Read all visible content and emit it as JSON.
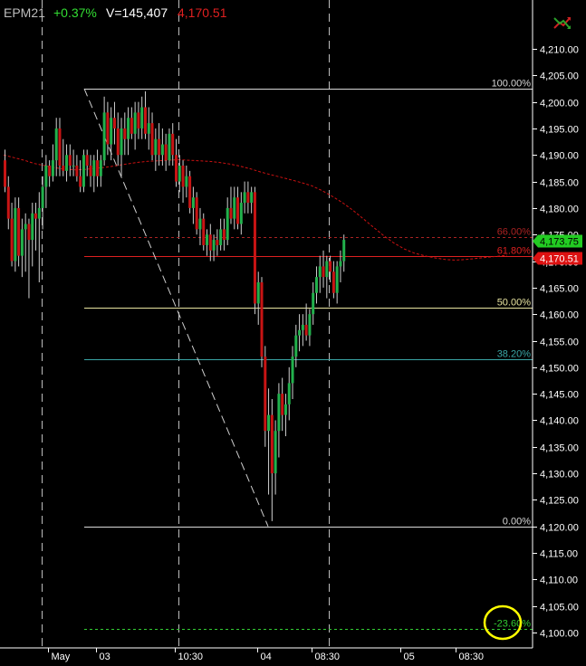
{
  "header": {
    "symbol": "EPM21",
    "change": "+0.37%",
    "volume": "V=145,407",
    "last": "4,170.51"
  },
  "colors": {
    "background": "#000000",
    "up": "#22b14c",
    "down": "#c81414",
    "header_symbol": "#bdbdbd",
    "header_change": "#33dd33",
    "header_volume": "#ffffff",
    "header_last": "#e02020",
    "ma": "#cc1111",
    "fib_100": "#d8d8d8",
    "fib_66": "#aa2222",
    "fib_618": "#dd2020",
    "fib_50": "#e8e4a0",
    "fib_382": "#3aa6a6",
    "fib_0": "#d8d8d8",
    "fib_neg236": "#33cc33",
    "price_tag_current": "#22cc22",
    "price_tag_last": "#dd1111",
    "highlight_circle": "#ffff00"
  },
  "chart_data": {
    "type": "candlestick",
    "instrument": "EPM21",
    "ylim": [
      4095,
      4215
    ],
    "y_ticks": [
      "4,100.00",
      "4,105.00",
      "4,110.00",
      "4,115.00",
      "4,120.00",
      "4,125.00",
      "4,130.00",
      "4,135.00",
      "4,140.00",
      "4,145.00",
      "4,150.00",
      "4,155.00",
      "4,160.00",
      "4,165.00",
      "4,170.00",
      "4,175.00",
      "4,180.00",
      "4,185.00",
      "4,190.00",
      "4,195.00",
      "4,200.00",
      "4,205.00",
      "4,210.00"
    ],
    "y_tick_values": [
      4100,
      4105,
      4110,
      4115,
      4120,
      4125,
      4130,
      4135,
      4140,
      4145,
      4150,
      4155,
      4160,
      4165,
      4170,
      4175,
      4180,
      4185,
      4190,
      4195,
      4200,
      4205,
      4210
    ],
    "x_ticks": [
      {
        "label": "May",
        "bar": 13
      },
      {
        "label": "03",
        "bar": 27
      },
      {
        "label": "10:30",
        "bar": 50
      },
      {
        "label": "04",
        "bar": 74
      },
      {
        "label": "08:30",
        "bar": 90
      },
      {
        "label": "05",
        "bar": 116
      },
      {
        "label": "08:30",
        "bar": 132
      }
    ],
    "session_dividers": [
      11,
      51,
      95
    ],
    "candles": [
      {
        "o": 4189,
        "h": 4191,
        "l": 4183,
        "c": 4184
      },
      {
        "o": 4184,
        "h": 4186,
        "l": 4176,
        "c": 4178
      },
      {
        "o": 4178,
        "h": 4181,
        "l": 4169,
        "c": 4170
      },
      {
        "o": 4170,
        "h": 4182,
        "l": 4168,
        "c": 4180
      },
      {
        "o": 4180,
        "h": 4182,
        "l": 4169,
        "c": 4171
      },
      {
        "o": 4171,
        "h": 4178,
        "l": 4167,
        "c": 4176
      },
      {
        "o": 4176,
        "h": 4179,
        "l": 4168,
        "c": 4177
      },
      {
        "o": 4177,
        "h": 4178,
        "l": 4163,
        "c": 4174
      },
      {
        "o": 4174,
        "h": 4181,
        "l": 4169,
        "c": 4179
      },
      {
        "o": 4179,
        "h": 4181,
        "l": 4172,
        "c": 4178
      },
      {
        "o": 4178,
        "h": 4183,
        "l": 4166,
        "c": 4180
      },
      {
        "o": 4180,
        "h": 4186,
        "l": 4176,
        "c": 4184
      },
      {
        "o": 4184,
        "h": 4190,
        "l": 4180,
        "c": 4188
      },
      {
        "o": 4188,
        "h": 4189,
        "l": 4184,
        "c": 4186
      },
      {
        "o": 4186,
        "h": 4192,
        "l": 4185,
        "c": 4189
      },
      {
        "o": 4189,
        "h": 4197,
        "l": 4186,
        "c": 4195
      },
      {
        "o": 4195,
        "h": 4197,
        "l": 4186,
        "c": 4188
      },
      {
        "o": 4188,
        "h": 4193,
        "l": 4186,
        "c": 4187
      },
      {
        "o": 4187,
        "h": 4192,
        "l": 4185,
        "c": 4190
      },
      {
        "o": 4190,
        "h": 4192,
        "l": 4186,
        "c": 4188
      },
      {
        "o": 4188,
        "h": 4191,
        "l": 4186,
        "c": 4188
      },
      {
        "o": 4188,
        "h": 4190,
        "l": 4185,
        "c": 4186
      },
      {
        "o": 4186,
        "h": 4189,
        "l": 4183,
        "c": 4184
      },
      {
        "o": 4184,
        "h": 4191,
        "l": 4183,
        "c": 4190
      },
      {
        "o": 4190,
        "h": 4191,
        "l": 4186,
        "c": 4188
      },
      {
        "o": 4188,
        "h": 4190,
        "l": 4184,
        "c": 4186
      },
      {
        "o": 4186,
        "h": 4190,
        "l": 4183,
        "c": 4189
      },
      {
        "o": 4189,
        "h": 4191,
        "l": 4184,
        "c": 4186
      },
      {
        "o": 4186,
        "h": 4190,
        "l": 4184,
        "c": 4189
      },
      {
        "o": 4189,
        "h": 4201,
        "l": 4188,
        "c": 4198
      },
      {
        "o": 4198,
        "h": 4200,
        "l": 4190,
        "c": 4192
      },
      {
        "o": 4192,
        "h": 4199,
        "l": 4189,
        "c": 4197
      },
      {
        "o": 4197,
        "h": 4200,
        "l": 4192,
        "c": 4195
      },
      {
        "o": 4195,
        "h": 4198,
        "l": 4188,
        "c": 4190
      },
      {
        "o": 4190,
        "h": 4197,
        "l": 4186,
        "c": 4195
      },
      {
        "o": 4195,
        "h": 4198,
        "l": 4190,
        "c": 4193
      },
      {
        "o": 4193,
        "h": 4199,
        "l": 4190,
        "c": 4197
      },
      {
        "o": 4197,
        "h": 4199,
        "l": 4193,
        "c": 4194
      },
      {
        "o": 4194,
        "h": 4200,
        "l": 4191,
        "c": 4198
      },
      {
        "o": 4198,
        "h": 4200,
        "l": 4193,
        "c": 4195
      },
      {
        "o": 4195,
        "h": 4201,
        "l": 4193,
        "c": 4199
      },
      {
        "o": 4199,
        "h": 4202,
        "l": 4193,
        "c": 4194
      },
      {
        "o": 4194,
        "h": 4199,
        "l": 4191,
        "c": 4196
      },
      {
        "o": 4196,
        "h": 4198,
        "l": 4189,
        "c": 4190
      },
      {
        "o": 4190,
        "h": 4195,
        "l": 4187,
        "c": 4193
      },
      {
        "o": 4193,
        "h": 4196,
        "l": 4188,
        "c": 4190
      },
      {
        "o": 4190,
        "h": 4195,
        "l": 4188,
        "c": 4192
      },
      {
        "o": 4192,
        "h": 4194,
        "l": 4187,
        "c": 4189
      },
      {
        "o": 4189,
        "h": 4195,
        "l": 4188,
        "c": 4194
      },
      {
        "o": 4194,
        "h": 4196,
        "l": 4188,
        "c": 4190
      },
      {
        "o": 4190,
        "h": 4193,
        "l": 4184,
        "c": 4185
      },
      {
        "o": 4185,
        "h": 4190,
        "l": 4183,
        "c": 4188
      },
      {
        "o": 4188,
        "h": 4189,
        "l": 4181,
        "c": 4184
      },
      {
        "o": 4184,
        "h": 4188,
        "l": 4182,
        "c": 4186
      },
      {
        "o": 4186,
        "h": 4187,
        "l": 4179,
        "c": 4180
      },
      {
        "o": 4180,
        "h": 4184,
        "l": 4177,
        "c": 4182
      },
      {
        "o": 4182,
        "h": 4183,
        "l": 4175,
        "c": 4176
      },
      {
        "o": 4176,
        "h": 4180,
        "l": 4173,
        "c": 4178
      },
      {
        "o": 4178,
        "h": 4179,
        "l": 4172,
        "c": 4173
      },
      {
        "o": 4173,
        "h": 4176,
        "l": 4171,
        "c": 4175
      },
      {
        "o": 4175,
        "h": 4177,
        "l": 4170,
        "c": 4172
      },
      {
        "o": 4172,
        "h": 4175,
        "l": 4170,
        "c": 4174
      },
      {
        "o": 4174,
        "h": 4176,
        "l": 4171,
        "c": 4173
      },
      {
        "o": 4173,
        "h": 4178,
        "l": 4172,
        "c": 4176
      },
      {
        "o": 4176,
        "h": 4178,
        "l": 4172,
        "c": 4174
      },
      {
        "o": 4174,
        "h": 4182,
        "l": 4173,
        "c": 4180
      },
      {
        "o": 4180,
        "h": 4184,
        "l": 4177,
        "c": 4178
      },
      {
        "o": 4178,
        "h": 4184,
        "l": 4176,
        "c": 4182
      },
      {
        "o": 4182,
        "h": 4184,
        "l": 4176,
        "c": 4177
      },
      {
        "o": 4177,
        "h": 4183,
        "l": 4175,
        "c": 4181
      },
      {
        "o": 4181,
        "h": 4185,
        "l": 4179,
        "c": 4183
      },
      {
        "o": 4183,
        "h": 4185,
        "l": 4179,
        "c": 4181
      },
      {
        "o": 4181,
        "h": 4184,
        "l": 4179,
        "c": 4183
      },
      {
        "o": 4183,
        "h": 4184,
        "l": 4160,
        "c": 4162
      },
      {
        "o": 4162,
        "h": 4168,
        "l": 4158,
        "c": 4166
      },
      {
        "o": 4166,
        "h": 4167,
        "l": 4150,
        "c": 4152
      },
      {
        "o": 4152,
        "h": 4154,
        "l": 4135,
        "c": 4138
      },
      {
        "o": 4138,
        "h": 4146,
        "l": 4126,
        "c": 4141
      },
      {
        "o": 4141,
        "h": 4144,
        "l": 4121,
        "c": 4130
      },
      {
        "o": 4130,
        "h": 4140,
        "l": 4126,
        "c": 4138
      },
      {
        "o": 4138,
        "h": 4147,
        "l": 4133,
        "c": 4145
      },
      {
        "o": 4145,
        "h": 4148,
        "l": 4138,
        "c": 4141
      },
      {
        "o": 4141,
        "h": 4145,
        "l": 4137,
        "c": 4143
      },
      {
        "o": 4143,
        "h": 4150,
        "l": 4140,
        "c": 4147
      },
      {
        "o": 4147,
        "h": 4154,
        "l": 4144,
        "c": 4152
      },
      {
        "o": 4152,
        "h": 4158,
        "l": 4150,
        "c": 4156
      },
      {
        "o": 4156,
        "h": 4160,
        "l": 4153,
        "c": 4157
      },
      {
        "o": 4157,
        "h": 4160,
        "l": 4154,
        "c": 4158
      },
      {
        "o": 4158,
        "h": 4162,
        "l": 4155,
        "c": 4156
      },
      {
        "o": 4156,
        "h": 4161,
        "l": 4154,
        "c": 4160
      },
      {
        "o": 4160,
        "h": 4166,
        "l": 4158,
        "c": 4164
      },
      {
        "o": 4164,
        "h": 4169,
        "l": 4162,
        "c": 4167
      },
      {
        "o": 4167,
        "h": 4171,
        "l": 4164,
        "c": 4169
      },
      {
        "o": 4169,
        "h": 4172,
        "l": 4165,
        "c": 4167
      },
      {
        "o": 4167,
        "h": 4171,
        "l": 4163,
        "c": 4170
      },
      {
        "o": 4170,
        "h": 4171,
        "l": 4166,
        "c": 4168
      },
      {
        "o": 4168,
        "h": 4170,
        "l": 4163,
        "c": 4164
      },
      {
        "o": 4164,
        "h": 4170,
        "l": 4162,
        "c": 4169
      },
      {
        "o": 4169,
        "h": 4172,
        "l": 4166,
        "c": 4170
      },
      {
        "o": 4170,
        "h": 4175,
        "l": 4168,
        "c": 4174
      }
    ],
    "moving_average": [
      4190,
      4189.5,
      4189,
      4188.4,
      4188,
      4187.6,
      4187.3,
      4187.2,
      4187.3,
      4187.5,
      4187.7,
      4188,
      4188.3,
      4188.6,
      4188.8,
      4188.9,
      4189,
      4189.1,
      4189,
      4188.9,
      4188.8,
      4188.6,
      4188.3,
      4187.9,
      4187.4,
      4186.8,
      4186.3,
      4185.8,
      4185.3,
      4184.8,
      4184.2,
      4183.3,
      4182.2,
      4181,
      4179.6,
      4178,
      4176.4,
      4174.8,
      4173.4,
      4172.3,
      4171.5,
      4171,
      4170.6,
      4170.3,
      4170.2,
      4170.3,
      4170.5,
      4170.7,
      4170.9,
      4171.1
    ],
    "fib_levels": [
      {
        "label": "100.00%",
        "price": 4202.5,
        "key": "fib_100",
        "dash": false
      },
      {
        "label": "66.00%",
        "price": 4174.5,
        "key": "fib_66",
        "dash": true
      },
      {
        "label": "61.80%",
        "price": 4171,
        "key": "fib_618",
        "dash": false
      },
      {
        "label": "50.00%",
        "price": 4161.25,
        "key": "fib_50",
        "dash": false
      },
      {
        "label": "38.20%",
        "price": 4151.5,
        "key": "fib_382",
        "dash": false
      },
      {
        "label": "0.00%",
        "price": 4120,
        "key": "fib_0",
        "dash": false
      },
      {
        "label": "-23.60%",
        "price": 4100.75,
        "key": "fib_neg236",
        "dash": true
      }
    ],
    "fib_anchor": {
      "high_bar": 20,
      "high_price": 4202.5,
      "low_bar": 66,
      "low_price": 4120
    },
    "price_tags": [
      {
        "label": "4,173.75",
        "price": 4173.75,
        "key": "price_tag_current"
      },
      {
        "label": "4,170.51",
        "price": 4170.51,
        "key": "price_tag_last"
      }
    ],
    "grid": false
  }
}
